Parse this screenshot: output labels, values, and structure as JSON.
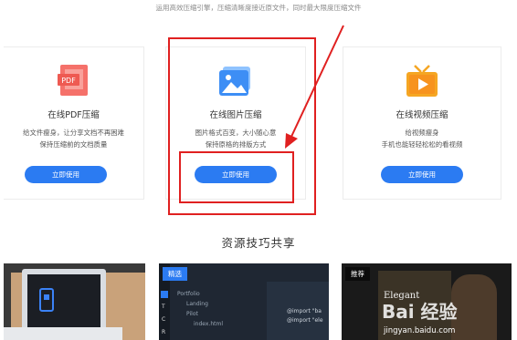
{
  "tagline": "运用高效压缩引擎，压缩清晰度接近原文件，同时最大限度压缩文件",
  "cards": [
    {
      "icon": "pdf-file-icon",
      "icon_label": "PDF",
      "title": "在线PDF压缩",
      "desc_line1": "给文件瘦身，让分享文档不再困难",
      "desc_line2": "保持压缩前的文档质量",
      "button": "立即使用"
    },
    {
      "icon": "image-icon",
      "title": "在线图片压缩",
      "desc_line1": "图片格式百变，大小随心意",
      "desc_line2": "保持原格的排版方式",
      "button": "立即使用"
    },
    {
      "icon": "tv-play-icon",
      "title": "在线视频压缩",
      "desc_line1": "给视频瘦身",
      "desc_line2": "手机也能轻轻松松的看视频",
      "button": "立即使用"
    }
  ],
  "section_title": "资源技巧共享",
  "thumbs": [
    {
      "tag": ""
    },
    {
      "tag": "精选",
      "code_lines": [
        "Portfolio",
        "Landing",
        "Pilot",
        "index.html"
      ],
      "code_right": [
        "@import \"ba",
        "@import \"ele"
      ]
    },
    {
      "tag": "推荐",
      "poster_text": "Elegant"
    }
  ],
  "watermark": {
    "text": "Bai 经验",
    "url": "jingyan.baidu.com"
  },
  "colors": {
    "accent": "#2b7bf2",
    "annotation": "#e02020"
  }
}
